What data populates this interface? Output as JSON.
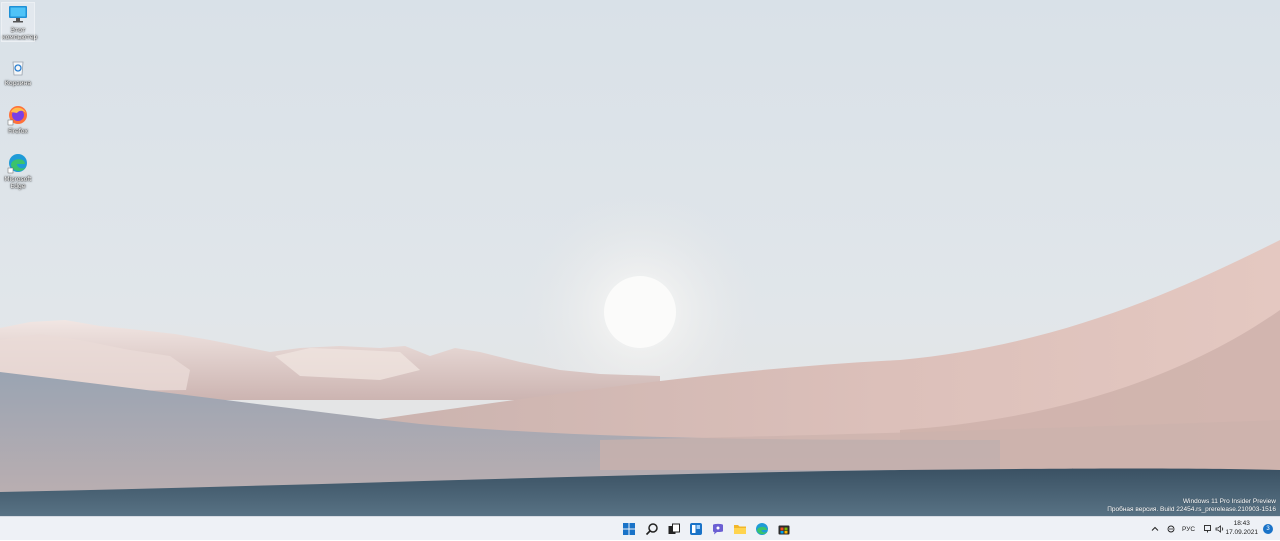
{
  "desktop": {
    "icons": [
      {
        "label": "Этот компьютер",
        "icon": "monitor-icon"
      },
      {
        "label": "Корзина",
        "icon": "recycle-bin-icon"
      },
      {
        "label": "Firefox",
        "icon": "firefox-icon"
      },
      {
        "label": "Microsoft Edge",
        "icon": "edge-icon"
      }
    ],
    "watermark": {
      "line1": "Windows 11 Pro Insider Preview",
      "line2": "Пробная версия. Build 22454.rs_prerelease.210903-1516"
    }
  },
  "taskbar": {
    "pinned": [
      "start-icon",
      "search-icon",
      "task-view-icon",
      "widgets-icon",
      "chat-icon",
      "file-explorer-icon",
      "edge-icon",
      "store-icon"
    ],
    "tray": {
      "language": "РУС",
      "time": "18:43",
      "date": "17.09.2021",
      "notification_count": "3"
    }
  },
  "colors": {
    "sky": "#dde4ea",
    "dunes": "#d9bcb6",
    "water": "#44596a",
    "taskbar": "#eef1f6",
    "accent": "#1a73c8"
  }
}
